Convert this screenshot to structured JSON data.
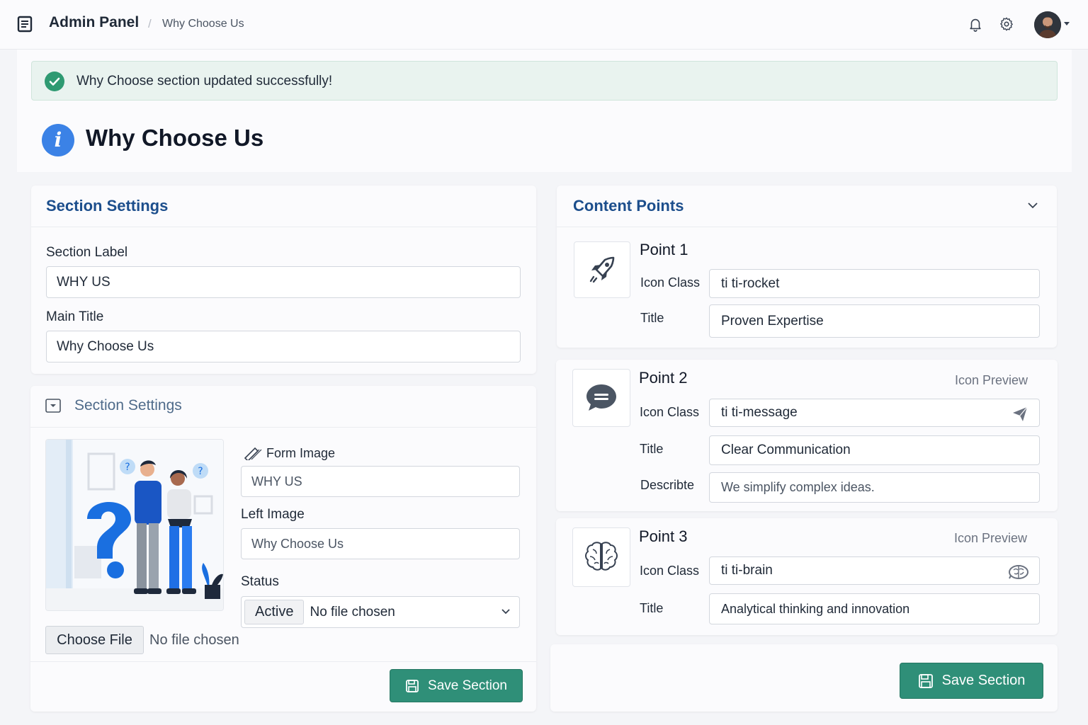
{
  "header": {
    "brand": "Admin Panel",
    "separator": "/",
    "breadcrumb": "Why Choose Us"
  },
  "alert": {
    "message": "Why Choose section updated successfully!"
  },
  "page": {
    "title": "Why Choose Us",
    "icon": "info-icon"
  },
  "section_settings": {
    "title": "Section Settings",
    "label_label": "Section Label",
    "label_value": "WHY US",
    "main_title_label": "Main Title",
    "main_title_value": "Why Choose Us"
  },
  "section_settings_2": {
    "title": "Section Settings",
    "form_image_label": "Form Image",
    "form_image_value": "WHY US",
    "left_image_label": "Left Image",
    "left_image_value": "Why Choose Us",
    "status_label": "Status",
    "status_value": "Active",
    "status_file_text": "No file chosen",
    "choose_file_label": "Choose File",
    "no_file_text": "No file chosen",
    "save_label": "Save Section"
  },
  "content_points": {
    "title": "Content Points",
    "points": [
      {
        "title": "Point 1",
        "icon_class_label": "Icon Class",
        "icon_class": "ti ti-rocket",
        "title_label": "Title",
        "title_value": "Proven Expertise"
      },
      {
        "title": "Point 2",
        "preview_label": "Icon Preview",
        "icon_class_label": "Icon Class",
        "icon_class": "ti ti-message",
        "title_label": "Title",
        "title_value": "Clear Communication",
        "describe_label": "Describte",
        "describe_value": "We simplify complex ideas."
      },
      {
        "title": "Point 3",
        "preview_label": "Icon Preview",
        "icon_class_label": "Icon Class",
        "icon_class": "ti ti-brain",
        "title_label": "Title",
        "title_value": "Analytical thinking and innovation"
      }
    ],
    "save_label": "Save Section"
  },
  "colors": {
    "primary": "#2f8f78",
    "heading": "#1c4e8c",
    "info": "#3b82e6",
    "success": "#2f9a72"
  }
}
